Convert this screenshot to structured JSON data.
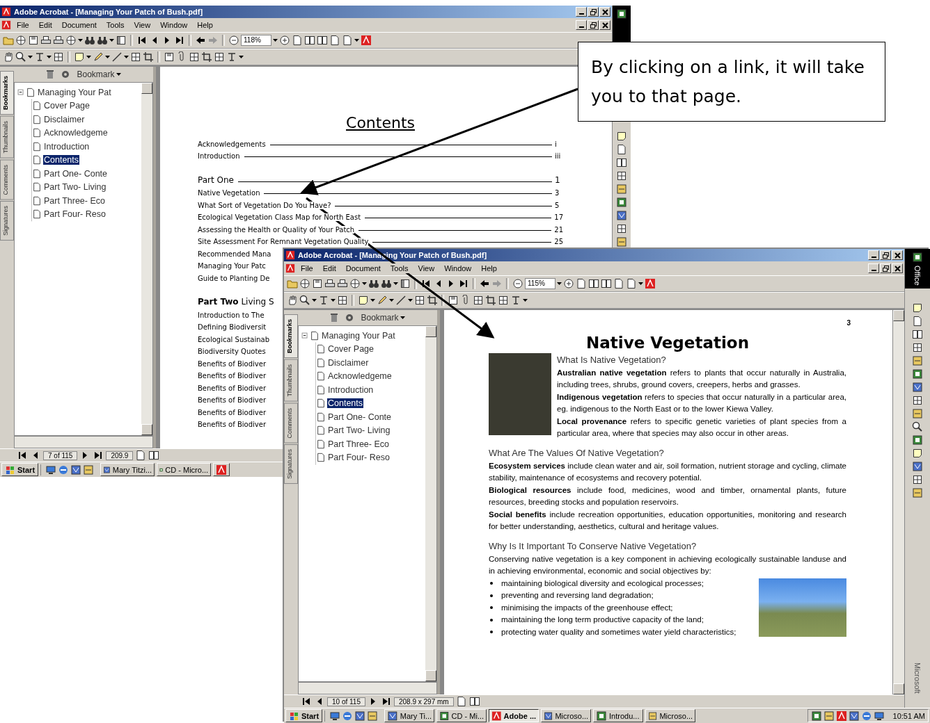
{
  "callout": {
    "text": "By clicking on a link, it will take you to that page."
  },
  "windows": [
    {
      "kind": "back",
      "title": "Adobe Acrobat - [Managing Your Patch of Bush.pdf]",
      "menu": [
        "File",
        "Edit",
        "Document",
        "Tools",
        "View",
        "Window",
        "Help"
      ],
      "zoom": "118%",
      "nav_tabs": [
        {
          "label": "Bookmarks",
          "selected": true
        },
        {
          "label": "Thumbnails",
          "selected": false
        },
        {
          "label": "Comments",
          "selected": false
        },
        {
          "label": "Signatures",
          "selected": false
        }
      ],
      "bookmark_menu": "Bookmark",
      "bookmarks": {
        "label": "Managing Your Pat",
        "expanded": true,
        "selected": false,
        "children": [
          {
            "label": "Cover Page",
            "selected": false
          },
          {
            "label": "Disclaimer",
            "selected": false
          },
          {
            "label": "Acknowledgeme",
            "selected": false
          },
          {
            "label": "Introduction",
            "selected": false
          },
          {
            "label": "Contents",
            "selected": true
          },
          {
            "label": "Part One- Conte",
            "selected": false
          },
          {
            "label": "Part Two- Living",
            "selected": false
          },
          {
            "label": "Part Three- Eco",
            "selected": false
          },
          {
            "label": "Part Four- Reso",
            "selected": false
          }
        ]
      },
      "page": {
        "kind": "contents",
        "title": "Contents",
        "entries": [
          {
            "kind": "entry",
            "text": "Acknowledgements",
            "page": "i"
          },
          {
            "kind": "entry",
            "text": "Introduction",
            "page": "iii"
          },
          {
            "kind": "heading",
            "text": "Part One",
            "page": "1"
          },
          {
            "kind": "entry",
            "text": "Native Vegetation",
            "page": "3"
          },
          {
            "kind": "entry",
            "text": "What Sort of Vegetation Do You Have?",
            "page": "5"
          },
          {
            "kind": "entry",
            "text": "Ecological Vegetation Class Map for North East",
            "page": "17"
          },
          {
            "kind": "entry",
            "text": "Assessing the Health or Quality of Your Patch",
            "page": "21"
          },
          {
            "kind": "entry",
            "text": "Site Assessment For Remnant Vegetation Quality",
            "page": "25"
          },
          {
            "kind": "entry",
            "text": "Recommended Mana"
          },
          {
            "kind": "entry",
            "text": "Managing Your Patc"
          },
          {
            "kind": "entry",
            "text": "Guide to Planting De"
          },
          {
            "kind": "heading",
            "text": "**Part Two** Living S"
          },
          {
            "kind": "entry",
            "text": "Introduction to The"
          },
          {
            "kind": "entry",
            "text": "Defining Biodiversit"
          },
          {
            "kind": "entry",
            "text": "Ecological Sustainab"
          },
          {
            "kind": "entry",
            "text": "Biodiversity Quotes"
          },
          {
            "kind": "entry",
            "text": "Benefits of Biodiver"
          },
          {
            "kind": "entry",
            "text": "Benefits of Biodiver"
          },
          {
            "kind": "entry",
            "text": "Benefits of Biodiver"
          },
          {
            "kind": "entry",
            "text": "Benefits of Biodiver"
          },
          {
            "kind": "entry",
            "text": "Benefits of Biodiver"
          },
          {
            "kind": "entry",
            "text": "Benefits of Biodiver"
          }
        ]
      },
      "status": {
        "page": "7 of 115",
        "size": "209.9"
      },
      "taskbar": {
        "start": "Start",
        "tasks": [
          {
            "kind": "labeled",
            "label": "Mary Titzi...",
            "selected": false
          },
          {
            "kind": "labeled",
            "label": "CD - Micro...",
            "selected": false
          },
          {
            "kind": "icon",
            "selected": false
          }
        ]
      }
    },
    {
      "kind": "front",
      "title": "Adobe Acrobat - [Managing Your Patch of Bush.pdf]",
      "menu": [
        "File",
        "Edit",
        "Document",
        "Tools",
        "View",
        "Window",
        "Help"
      ],
      "zoom": "115%",
      "nav_tabs": [
        {
          "label": "Bookmarks",
          "selected": true
        },
        {
          "label": "Thumbnails",
          "selected": false
        },
        {
          "label": "Comments",
          "selected": false
        },
        {
          "label": "Signatures",
          "selected": false
        }
      ],
      "bookmark_menu": "Bookmark",
      "bookmarks": {
        "label": "Managing Your Pat",
        "expanded": true,
        "selected": false,
        "children": [
          {
            "label": "Cover Page",
            "selected": false
          },
          {
            "label": "Disclaimer",
            "selected": false
          },
          {
            "label": "Acknowledgeme",
            "selected": false
          },
          {
            "label": "Introduction",
            "selected": false
          },
          {
            "label": "Contents",
            "selected": true
          },
          {
            "label": "Part One- Conte",
            "selected": false
          },
          {
            "label": "Part Two- Living",
            "selected": false
          },
          {
            "label": "Part Three- Eco",
            "selected": false
          },
          {
            "label": "Part Four- Reso",
            "selected": false
          }
        ]
      },
      "page": {
        "kind": "article",
        "number": "3",
        "title": "Native Vegetation",
        "sections": [
          {
            "kind": "photo_left",
            "heading": "What Is Native Vegetation?",
            "paragraphs": [
              "**Australian native vegetation** refers to plants that occur naturally in Australia, including trees, shrubs, ground covers, creepers, herbs and grasses.",
              "**Indigenous vegetation** refers to species that occur naturally in a particular area, eg. indigenous to the North East or to the lower Kiewa Valley.",
              "**Local provenance** refers to specific genetic varieties of plant species from a particular area, where that species may also occur in other areas."
            ]
          },
          {
            "kind": "plain",
            "heading": "What Are The Values Of Native Vegetation?",
            "paragraphs": [
              "**Ecosystem services** include clean water and air, soil formation, nutrient storage and cycling, climate stability, maintenance of ecosystems and recovery potential.",
              "**Biological resources** include food, medicines, wood and timber, ornamental plants, future resources, breeding stocks and population reservoirs.",
              "**Social benefits** include recreation opportunities, education opportunities, monitoring and research for better understanding, aesthetics, cultural and heritage values."
            ]
          },
          {
            "kind": "photo_right",
            "heading": "Why Is It Important To Conserve Native Vegetation?",
            "paragraphs": [
              "Conserving native vegetation is a key component in achieving ecologically sustainable landuse and in achieving environmental, economic and social objectives by:"
            ],
            "bullets": [
              "maintaining biological diversity and ecological processes;",
              "preventing and reversing land degradation;",
              "minimising the impacts of the greenhouse effect;",
              "maintaining the long term productive capacity of the land;",
              "protecting water quality and sometimes water yield characteristics;"
            ]
          }
        ]
      },
      "status": {
        "page": "10 of 115",
        "size": "208.9 x 297 mm"
      },
      "office": {
        "title": "Office",
        "footer": "Microsoft"
      },
      "taskbar": {
        "start": "Start",
        "tasks": [
          {
            "kind": "labeled",
            "label": "Mary Ti...",
            "selected": false
          },
          {
            "kind": "labeled",
            "label": "CD - Mi...",
            "selected": false
          },
          {
            "kind": "labeled",
            "label": "Adobe ...",
            "selected": true
          },
          {
            "kind": "labeled",
            "label": "Microso...",
            "selected": false
          },
          {
            "kind": "labeled",
            "label": "Introdu...",
            "selected": false
          },
          {
            "kind": "labeled",
            "label": "Microso...",
            "selected": false
          }
        ],
        "clock": "10:51 AM"
      }
    }
  ]
}
